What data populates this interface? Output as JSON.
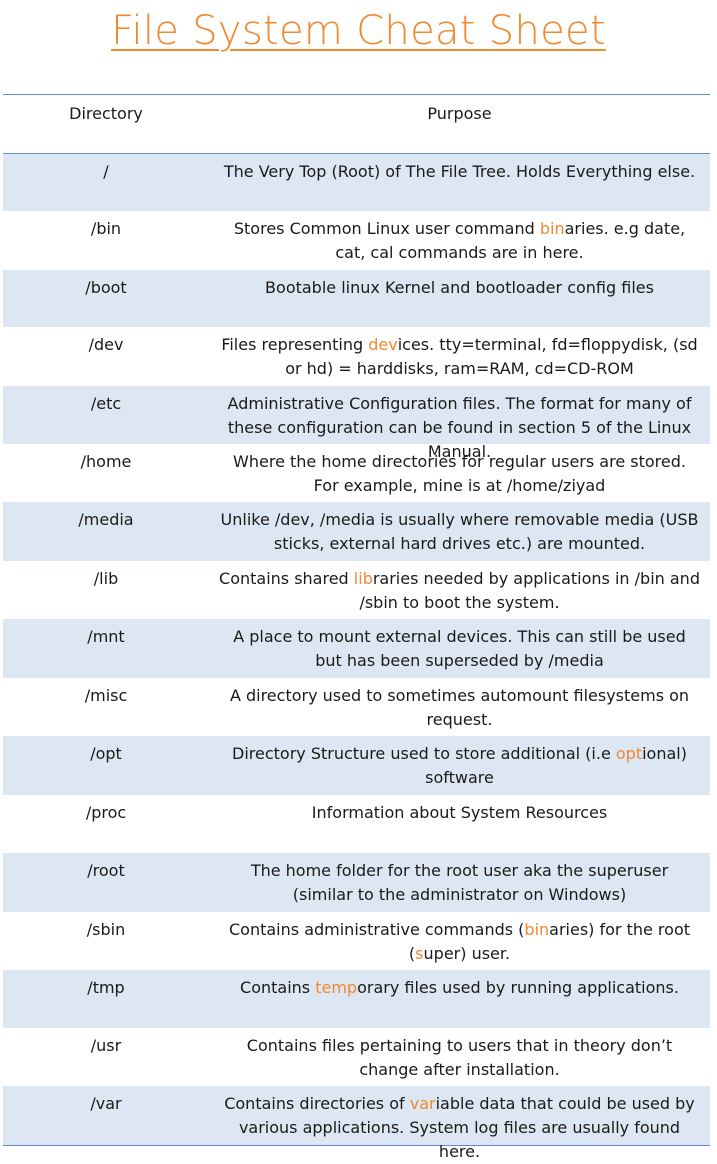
{
  "title": "File System Cheat Sheet",
  "headers": {
    "directory": "Directory",
    "purpose": "Purpose"
  },
  "accent_color": "#f0892f",
  "rule_color": "#5b8fc7",
  "shade_color": "#dde6f3",
  "rows": [
    {
      "dir": "/",
      "parts": [
        [
          "The Very Top (Root) of The File Tree. Holds Everything else.",
          0
        ]
      ]
    },
    {
      "dir": "/bin",
      "parts": [
        [
          "Stores Common Linux user command ",
          0
        ],
        [
          "bin",
          1
        ],
        [
          "aries. e.g date, cat, cal commands are in here.",
          0
        ]
      ]
    },
    {
      "dir": "/boot",
      "parts": [
        [
          "Bootable linux Kernel and bootloader config files",
          0
        ]
      ]
    },
    {
      "dir": "/dev",
      "parts": [
        [
          "Files representing ",
          0
        ],
        [
          "dev",
          1
        ],
        [
          "ices. tty=terminal, fd=floppydisk, (sd or hd) = harddisks, ram=RAM, cd=CD-ROM",
          0
        ]
      ]
    },
    {
      "dir": "/etc",
      "parts": [
        [
          "Administrative Configuration files. The format for many of these configuration can be found in section 5 of the Linux Manual.",
          0
        ]
      ]
    },
    {
      "dir": "/home",
      "parts": [
        [
          "Where the home directories for regular users are stored. For example, mine is at /home/ziyad",
          0
        ]
      ]
    },
    {
      "dir": "/media",
      "parts": [
        [
          "Unlike /dev, /media is usually where removable media (USB sticks, external hard drives etc.) are mounted.",
          0
        ]
      ]
    },
    {
      "dir": "/lib",
      "parts": [
        [
          "Contains shared ",
          0
        ],
        [
          "lib",
          1
        ],
        [
          "raries needed by applications in /bin and /sbin to boot the system.",
          0
        ]
      ]
    },
    {
      "dir": "/mnt",
      "parts": [
        [
          "A place to mount external devices. This can still be used but has been superseded by /media",
          0
        ]
      ]
    },
    {
      "dir": "/misc",
      "parts": [
        [
          "A directory used to sometimes automount filesystems on request.",
          0
        ]
      ]
    },
    {
      "dir": "/opt",
      "parts": [
        [
          "Directory Structure used to store additional (i.e ",
          0
        ],
        [
          "opt",
          1
        ],
        [
          "ional) software",
          0
        ]
      ]
    },
    {
      "dir": "/proc",
      "parts": [
        [
          "Information about System Resources",
          0
        ]
      ]
    },
    {
      "dir": "/root",
      "parts": [
        [
          "The home folder for the root user aka the superuser (similar to the administrator on Windows)",
          0
        ]
      ]
    },
    {
      "dir": "/sbin",
      "parts": [
        [
          "Contains administrative commands (",
          0
        ],
        [
          "bin",
          1
        ],
        [
          "aries) for the root (",
          0
        ],
        [
          "s",
          1
        ],
        [
          "uper) user.",
          0
        ]
      ]
    },
    {
      "dir": "/tmp",
      "parts": [
        [
          "Contains ",
          0
        ],
        [
          "temp",
          1
        ],
        [
          "orary files used by running applications.",
          0
        ]
      ]
    },
    {
      "dir": "/usr",
      "parts": [
        [
          "Contains files pertaining to users that in theory don’t change after installation.",
          0
        ]
      ]
    },
    {
      "dir": "/var",
      "parts": [
        [
          "Contains directories of ",
          0
        ],
        [
          "var",
          1
        ],
        [
          "iable data that could be used by various applications. System log files are usually found here.",
          0
        ]
      ]
    }
  ]
}
